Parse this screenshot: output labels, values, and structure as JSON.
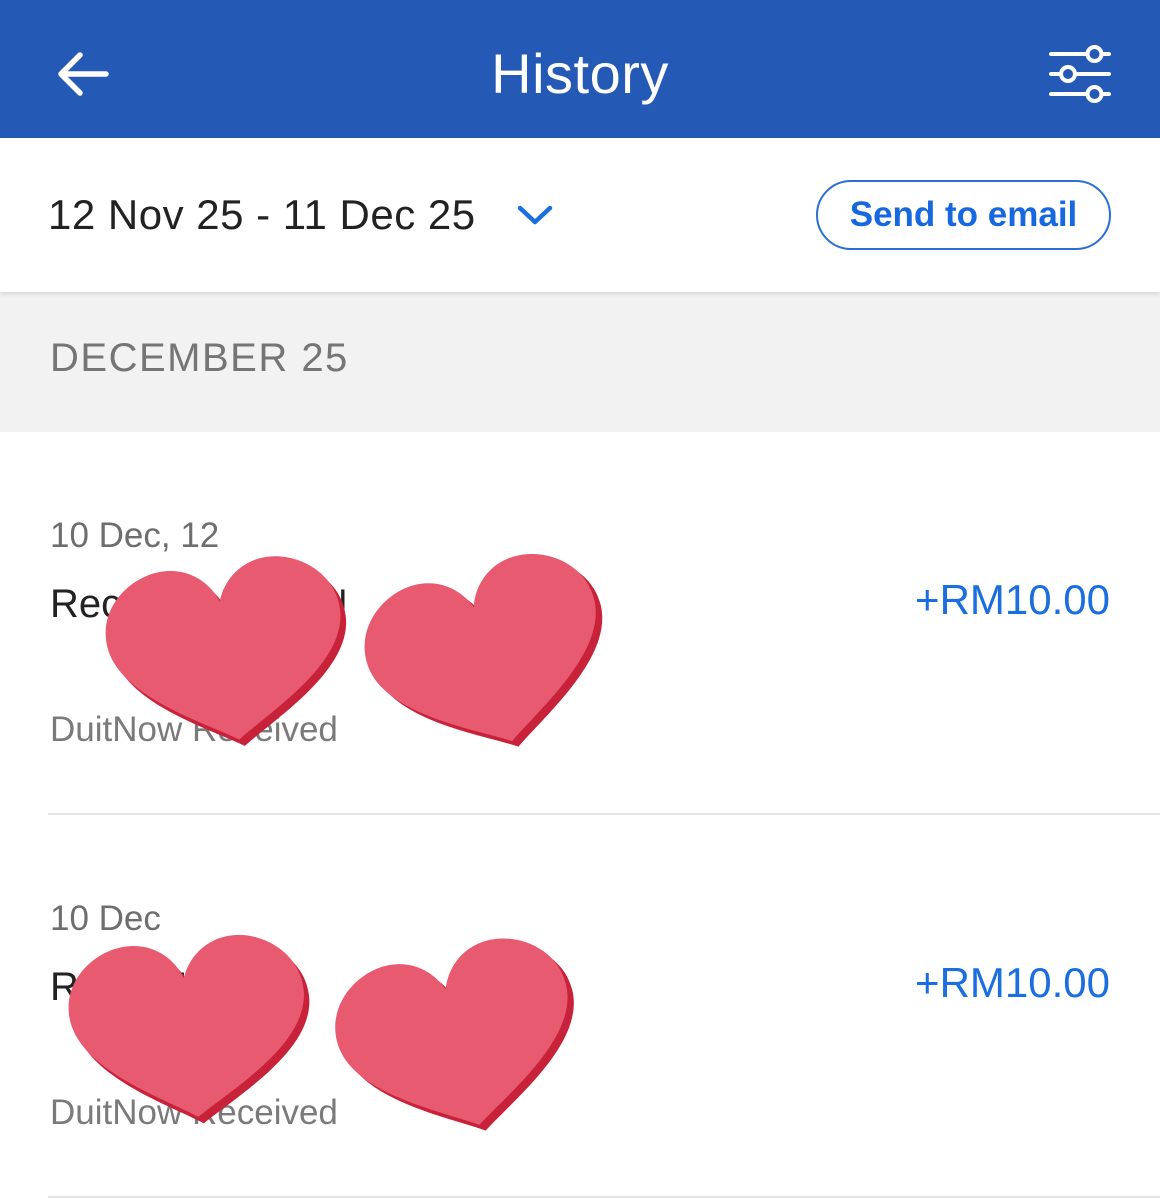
{
  "header": {
    "title": "History",
    "back_icon": "arrow-left-icon",
    "filter_icon": "sliders-icon",
    "background": "#2459b5"
  },
  "range": {
    "label": "12 Nov 25 - 11 Dec 25",
    "chevron_icon": "chevron-down-icon",
    "send_email_label": "Send to email"
  },
  "section": {
    "month_label": "DECEMBER 25"
  },
  "transactions": [
    {
      "time": "10 Dec, 12",
      "description": "Rec NU H BIN N",
      "type": "DuitNow Received",
      "amount": "+RM10.00"
    },
    {
      "time": "10 Dec",
      "description": "R n S FIT SA",
      "type": "DuitNow Received",
      "amount": "+RM10.00"
    }
  ],
  "colors": {
    "accent": "#1a6ee0",
    "heart": "#e85a70",
    "heart_shadow": "#c8223a"
  }
}
